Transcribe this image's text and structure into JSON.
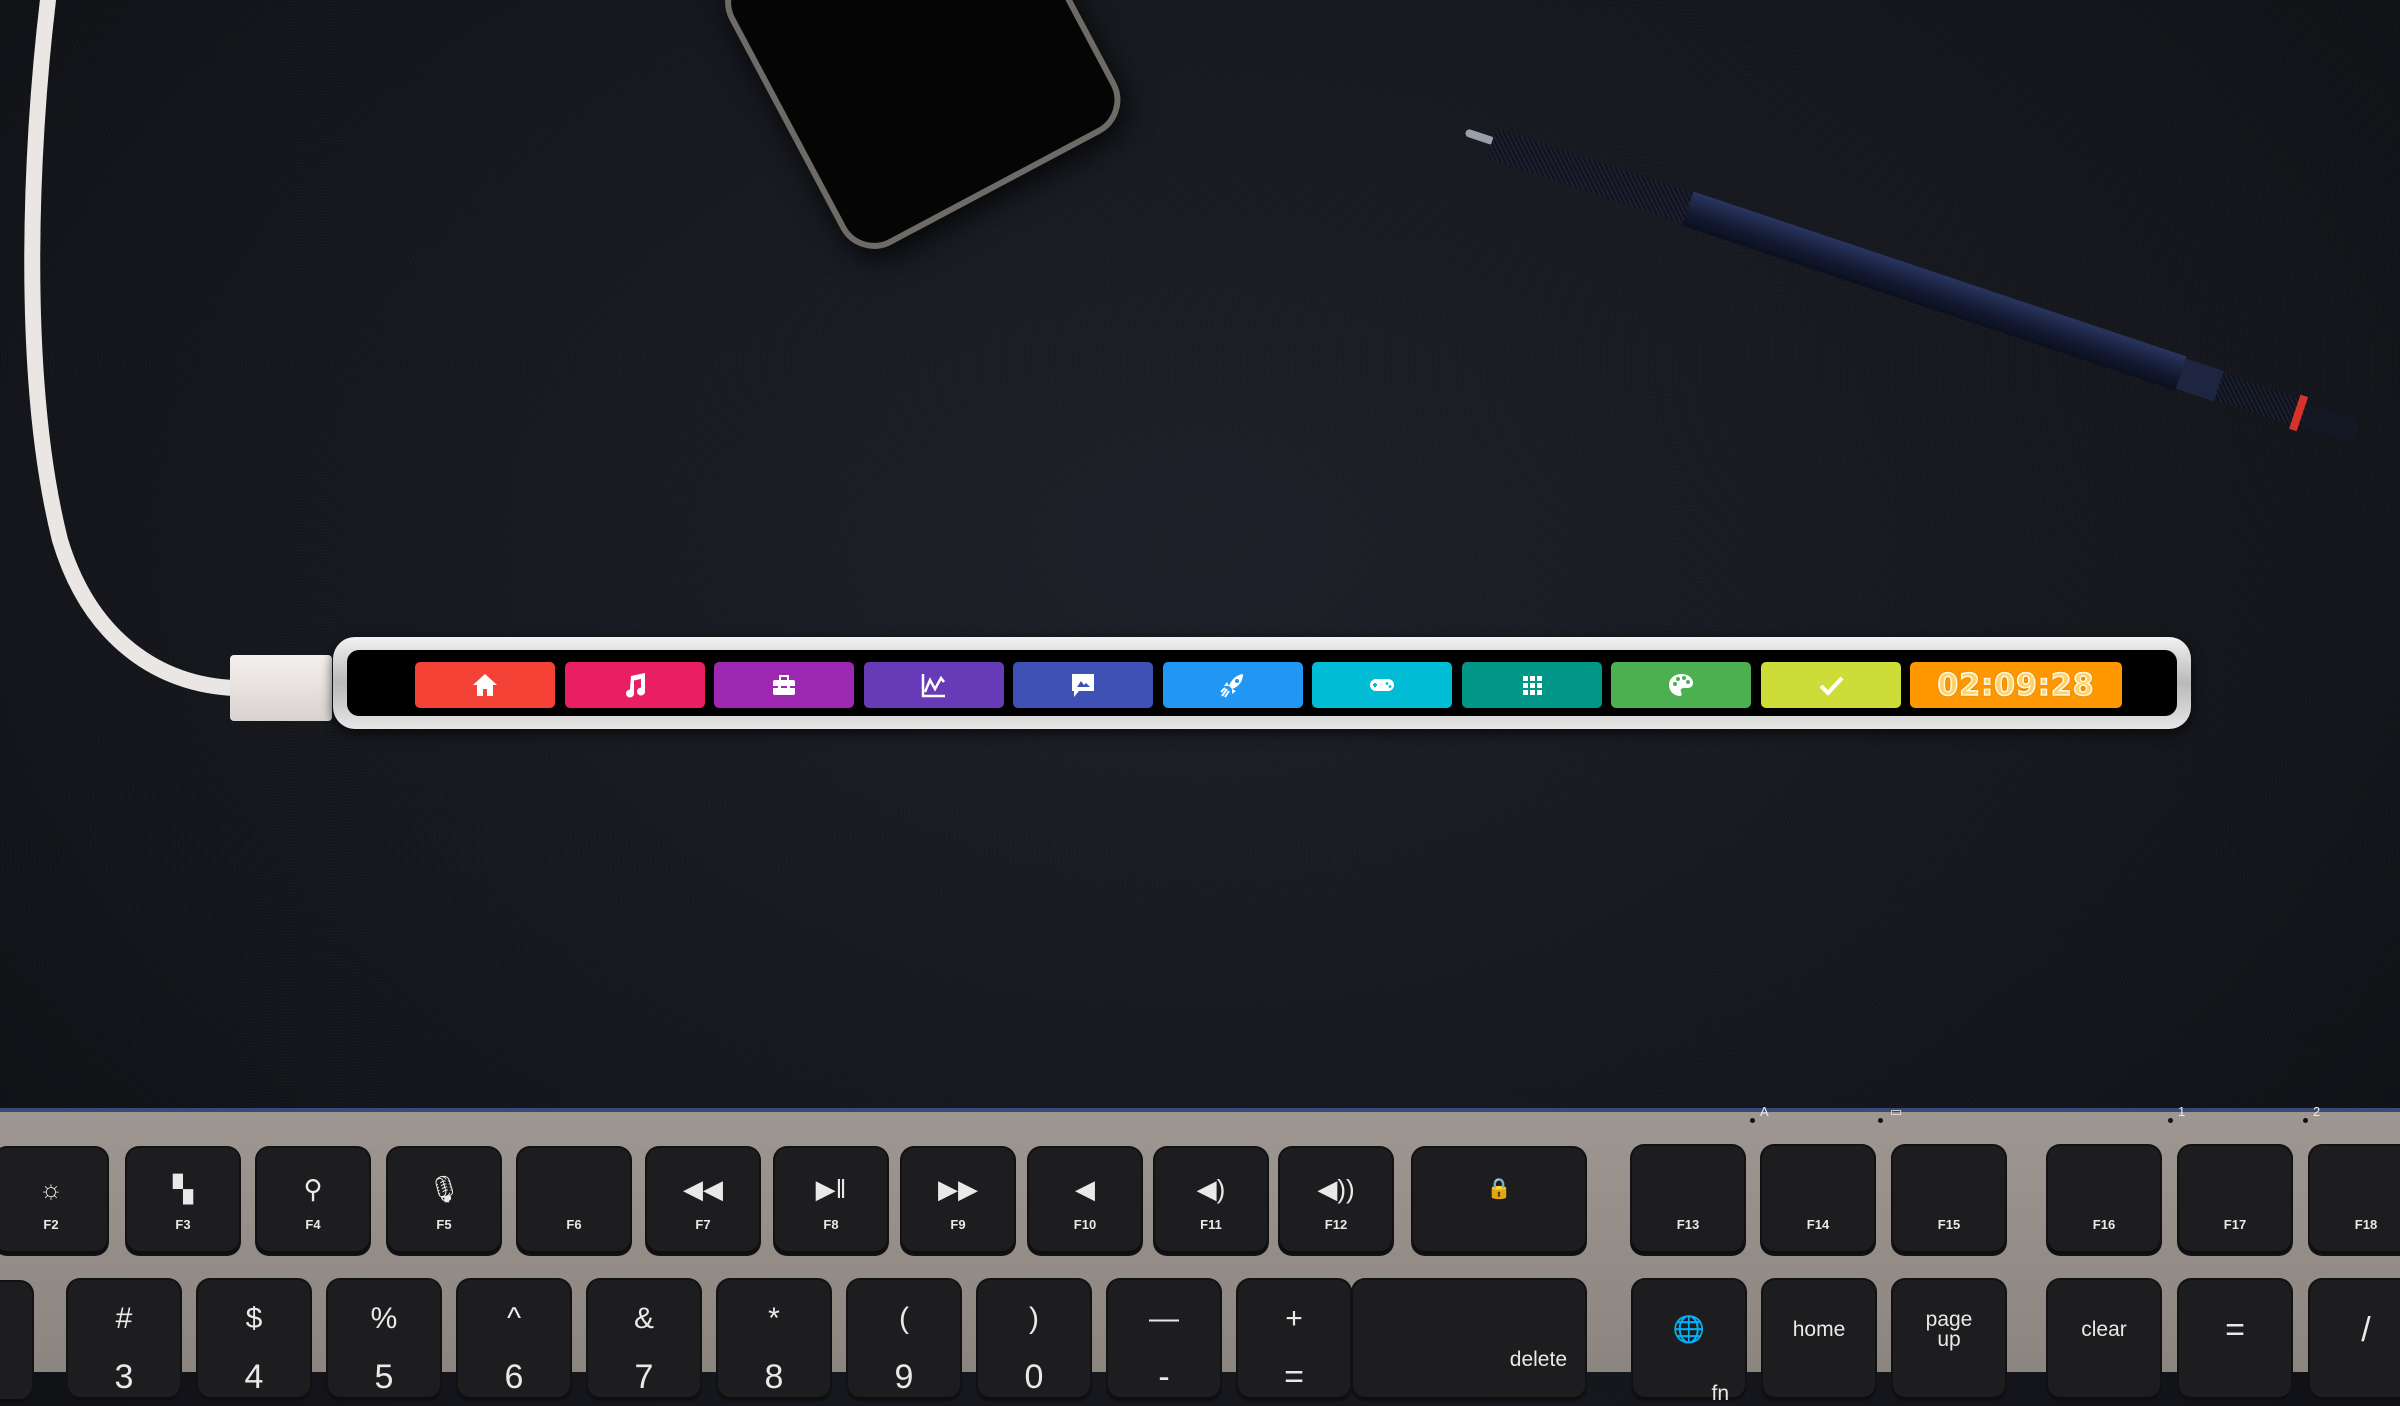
{
  "scene": {
    "description": "Desktop with a USB touch bar display above a keyboard",
    "background_color": "#14161c"
  },
  "touchbar": {
    "buttons": [
      {
        "name": "home",
        "icon": "home-icon",
        "color": "#f44336"
      },
      {
        "name": "music",
        "icon": "music-note-icon",
        "color": "#e91e63"
      },
      {
        "name": "toolbox",
        "icon": "toolbox-icon",
        "color": "#9c27b0"
      },
      {
        "name": "chart",
        "icon": "line-chart-icon",
        "color": "#673ab7"
      },
      {
        "name": "image-message",
        "icon": "image-message-icon",
        "color": "#3f51b5"
      },
      {
        "name": "rocket",
        "icon": "rocket-icon",
        "color": "#2196f3"
      },
      {
        "name": "gamepad",
        "icon": "gamepad-icon",
        "color": "#00bcd4"
      },
      {
        "name": "apps",
        "icon": "grid-apps-icon",
        "color": "#009688"
      },
      {
        "name": "palette",
        "icon": "palette-icon",
        "color": "#4caf50"
      },
      {
        "name": "check",
        "icon": "checkmark-icon",
        "color": "#cddc39"
      }
    ],
    "timer": {
      "value": "02:09:28",
      "color": "#ff9800"
    }
  },
  "keyboard": {
    "function_row": [
      {
        "label": "F2",
        "icon": "brightness-icon",
        "glyph": "☼"
      },
      {
        "label": "F3",
        "icon": "mission-control-icon",
        "glyph": "▚"
      },
      {
        "label": "F4",
        "icon": "search-icon",
        "glyph": "⚲"
      },
      {
        "label": "F5",
        "icon": "microphone-icon",
        "glyph": "🎙"
      },
      {
        "label": "F6",
        "icon": "",
        "glyph": ""
      },
      {
        "label": "F7",
        "icon": "rewind-icon",
        "glyph": "◀◀"
      },
      {
        "label": "F8",
        "icon": "play-pause-icon",
        "glyph": "▶‖"
      },
      {
        "label": "F9",
        "icon": "fast-forward-icon",
        "glyph": "▶▶"
      },
      {
        "label": "F10",
        "icon": "mute-icon",
        "glyph": "◀"
      },
      {
        "label": "F11",
        "icon": "volume-down-icon",
        "glyph": "◀)"
      },
      {
        "label": "F12",
        "icon": "volume-up-icon",
        "glyph": "◀))"
      }
    ],
    "lock_key": {
      "icon": "lock-icon",
      "glyph": "🔒"
    },
    "extended_function_row": [
      {
        "label": "F13"
      },
      {
        "label": "F14"
      },
      {
        "label": "F15"
      },
      {
        "label": "F16"
      },
      {
        "label": "F17"
      },
      {
        "label": "F18"
      }
    ],
    "indicators": {
      "caps": "A",
      "screen": "▭",
      "one": "1",
      "two": "2"
    },
    "number_row": [
      {
        "top": "#",
        "bottom": "3"
      },
      {
        "top": "$",
        "bottom": "4"
      },
      {
        "top": "%",
        "bottom": "5"
      },
      {
        "top": "^",
        "bottom": "6"
      },
      {
        "top": "&",
        "bottom": "7"
      },
      {
        "top": "*",
        "bottom": "8"
      },
      {
        "top": "(",
        "bottom": "9"
      },
      {
        "top": ")",
        "bottom": "0"
      },
      {
        "top": "—",
        "bottom": "-"
      },
      {
        "top": "+",
        "bottom": "="
      }
    ],
    "delete_label": "delete",
    "fn_key": {
      "icon": "globe-icon",
      "glyph": "🌐",
      "label": "fn"
    },
    "home_label": "home",
    "page_up_label": "page\nup",
    "clear_label": "clear",
    "equals_label": "=",
    "slash_label": "/"
  }
}
